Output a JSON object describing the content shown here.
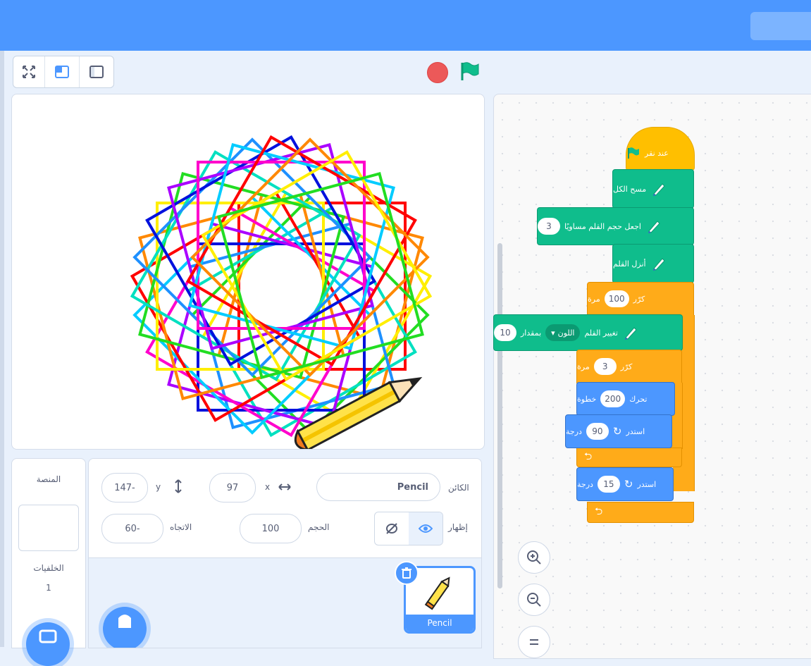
{
  "stage_header": {
    "modes": [
      "fullscreen-icon",
      "small-stage-icon",
      "large-stage-icon"
    ]
  },
  "sprite_info": {
    "sprite_label": "الكائن",
    "sprite_name": "Pencil",
    "x_label": "x",
    "x_value": "97",
    "y_label": "y",
    "y_value": "147-",
    "show_label": "إظهار",
    "size_label": "الحجم",
    "size_value": "100",
    "direction_label": "الاتجاه",
    "direction_value": "60-"
  },
  "sprites": [
    {
      "name": "Pencil"
    }
  ],
  "stage_panel": {
    "title": "المنصة",
    "backdrops_label": "الخلفيات",
    "backdrops_count": "1"
  },
  "code": {
    "when_flag": "عند نقر",
    "erase_all": "مسح الكل",
    "set_pen_size": "اجعل حجم القلم مساويًا",
    "pen_size_value": "3",
    "pen_down": "أنزل القلم",
    "repeat_label": "كرّر",
    "repeat_times_label": "مرة",
    "outer_repeat_value": "100",
    "change_pen_label": "تغيير القلم",
    "change_pen_by": "بمقدار",
    "change_pen_param": "اللون",
    "change_pen_value": "10",
    "inner_repeat_value": "3",
    "move_label": "تحرك",
    "move_steps_label": "خطوة",
    "move_value": "200",
    "turn_label": "استدر",
    "turn_degrees_label": "درجة",
    "turn_inner_value": "90",
    "turn_outer_value": "15"
  },
  "colors": {
    "accent": "#4c97ff",
    "event": "#ffbf00",
    "control": "#ffab19",
    "pen": "#0fbd8c",
    "motion": "#4c97ff",
    "stop": "#ec5959",
    "flag": "#0fbd8c"
  },
  "spiro_colors": [
    "#ff0000",
    "#ff8800",
    "#ffee00",
    "#22dd22",
    "#00e0c0",
    "#1e90ff",
    "#0011dd",
    "#aa00ff",
    "#ff00cc",
    "#00ccff"
  ]
}
